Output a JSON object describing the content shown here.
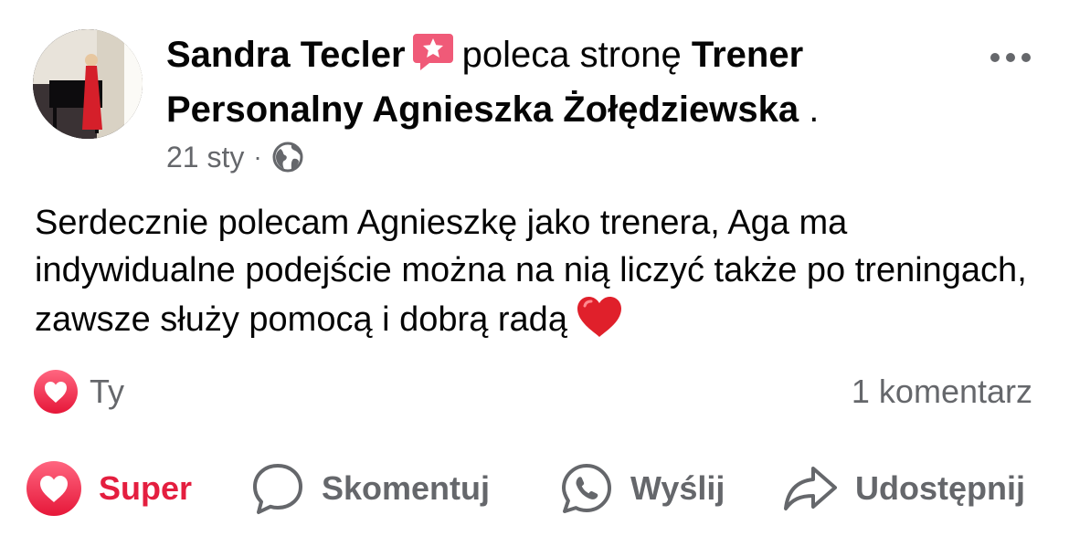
{
  "post": {
    "author": "Sandra Tecler",
    "action_text": "poleca stronę",
    "page_name": "Trener Personalny Agnieszka Żołędziewska",
    "trailing": " .",
    "date": "21 sty",
    "separator": "·",
    "body": "Serdecznie polecam Agnieszkę jako trenera, Aga ma indywidualne podejście można na nią liczyć także po treningach, zawsze służy pomocą i dobrą radą"
  },
  "reactions": {
    "who": "Ty"
  },
  "comments": {
    "count_label": "1 komentarz"
  },
  "actions": {
    "super": "Super",
    "comment": "Skomentuj",
    "send": "Wyślij",
    "share": "Udostępnij"
  },
  "colors": {
    "text": "#050505",
    "secondary": "#65676b",
    "super_red": "#e41e3f",
    "badge_pink": "#f05a78"
  }
}
